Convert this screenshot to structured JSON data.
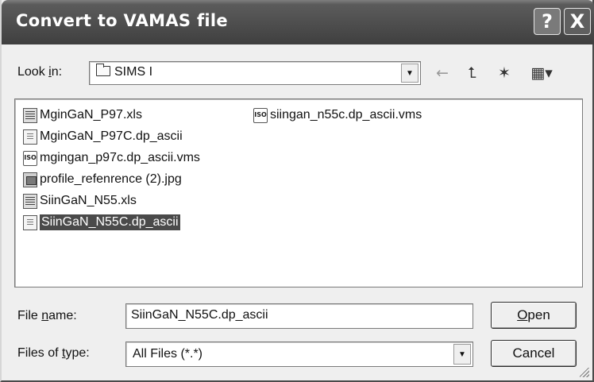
{
  "window": {
    "title": "Convert to VAMAS file",
    "help_glyph": "?",
    "close_glyph": "X"
  },
  "look_in": {
    "label_pre": "Look ",
    "label_key": "i",
    "label_post": "n:",
    "value": "SIMS I",
    "icon": "folder-icon"
  },
  "toolbar": {
    "back_glyph": "←",
    "up_glyph": "⮤",
    "new_folder_glyph": "✶",
    "view_glyph": "▦▾"
  },
  "files": [
    {
      "name": "MginGaN_P97.xls",
      "type": "xls",
      "badge": ""
    },
    {
      "name": "MginGaN_P97C.dp_ascii",
      "type": "txt",
      "badge": ""
    },
    {
      "name": "mgingan_p97c.dp_ascii.vms",
      "type": "vms",
      "badge": "ISO"
    },
    {
      "name": "profile_refenrence (2).jpg",
      "type": "jpg",
      "badge": ""
    },
    {
      "name": "SiinGaN_N55.xls",
      "type": "xls",
      "badge": ""
    },
    {
      "name": "SiinGaN_N55C.dp_ascii",
      "type": "txt",
      "badge": "",
      "selected": true
    },
    {
      "name": "siingan_n55c.dp_ascii.vms",
      "type": "vms",
      "badge": "ISO"
    }
  ],
  "file_name": {
    "label_pre": "File ",
    "label_key": "n",
    "label_post": "ame:",
    "value": "SiinGaN_N55C.dp_ascii"
  },
  "file_type": {
    "label_pre": "Files of ",
    "label_key": "t",
    "label_post": "ype:",
    "value": "All Files (*.*)"
  },
  "buttons": {
    "open_key": "O",
    "open_rest": "pen",
    "cancel": "Cancel"
  },
  "colors": {
    "titlebar": "#4f4f4f",
    "selection": "#4a4a4a",
    "dialog_bg": "#efefef"
  }
}
